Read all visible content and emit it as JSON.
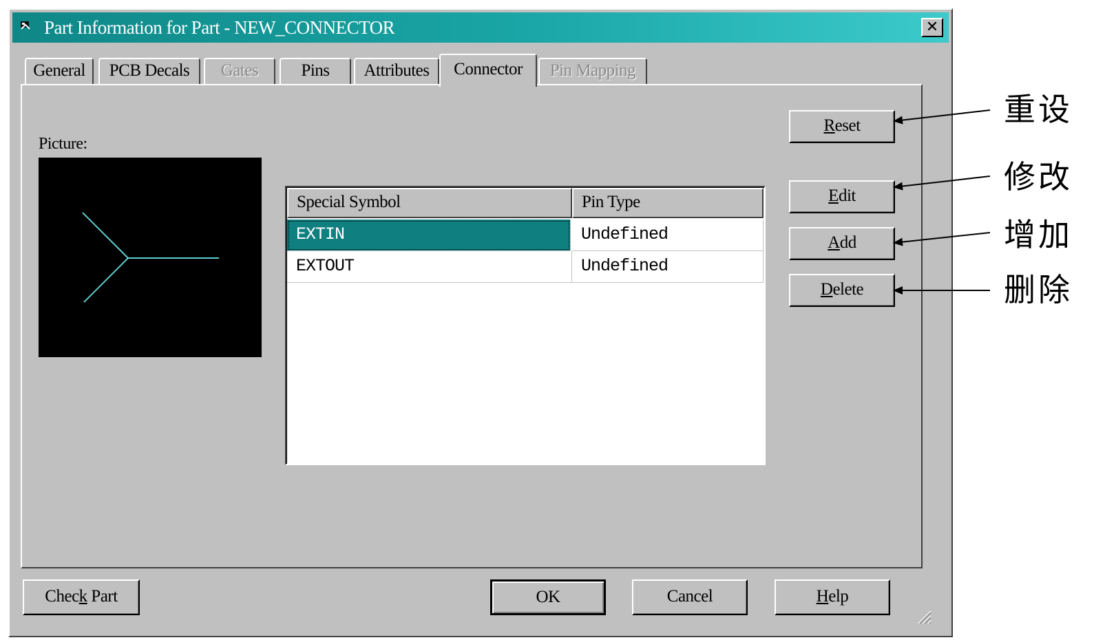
{
  "window": {
    "title": "Part Information for Part - NEW_CONNECTOR",
    "close_label": "✕"
  },
  "tabs": [
    {
      "label": "General",
      "state": "normal"
    },
    {
      "label": "PCB Decals",
      "state": "normal"
    },
    {
      "label": "Gates",
      "state": "disabled"
    },
    {
      "label": "Pins",
      "state": "normal"
    },
    {
      "label": "Attributes",
      "state": "normal"
    },
    {
      "label": "Connector",
      "state": "active"
    },
    {
      "label": "Pin Mapping",
      "state": "disabled"
    }
  ],
  "picture": {
    "label": "Picture:",
    "symbol": "connector-y-symbol",
    "line_color": "#5fcfcf"
  },
  "table": {
    "headers": [
      "Special Symbol",
      "Pin Type"
    ],
    "rows": [
      {
        "symbol": "EXTIN",
        "pin_type": "Undefined",
        "selected": true
      },
      {
        "symbol": "EXTOUT",
        "pin_type": "Undefined",
        "selected": false
      }
    ]
  },
  "side_buttons": [
    {
      "label": "Reset",
      "mnemonic": "R"
    },
    {
      "label": "Edit",
      "mnemonic": "E"
    },
    {
      "label": "Add",
      "mnemonic": "A"
    },
    {
      "label": "Delete",
      "mnemonic": "D"
    }
  ],
  "bottom_buttons": {
    "check_part": "Check Part",
    "check_part_mnemonic": "k",
    "ok": "OK",
    "cancel": "Cancel",
    "help": "Help",
    "help_mnemonic": "H"
  },
  "annotations": [
    {
      "text": "重设"
    },
    {
      "text": "修改"
    },
    {
      "text": "增加"
    },
    {
      "text": "删除"
    }
  ],
  "colors": {
    "title_bar": "#0f8787",
    "selection": "#0f7f7f",
    "face": "#c0c0c0"
  }
}
